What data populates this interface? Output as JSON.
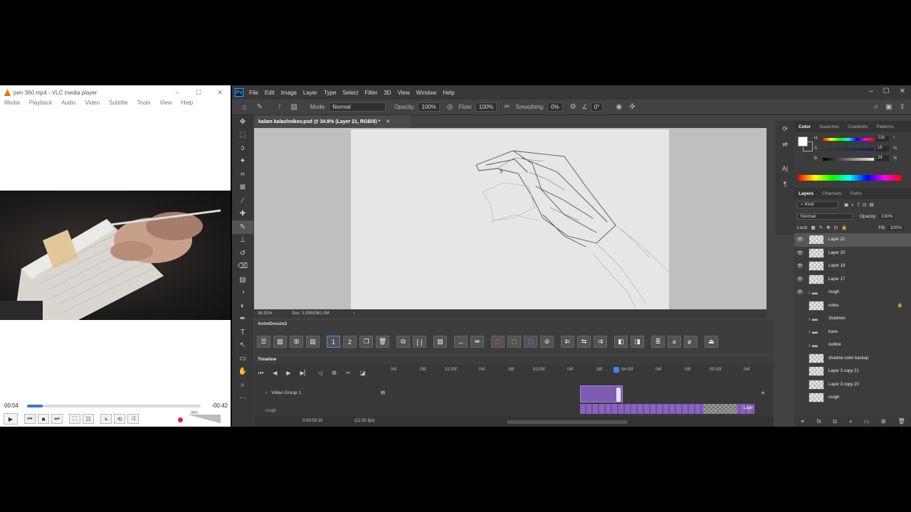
{
  "vlc": {
    "title": "pen 360.mp4 - VLC media player",
    "menu": [
      "Media",
      "Playback",
      "Audio",
      "Video",
      "Subtitle",
      "Tools",
      "View",
      "Help"
    ],
    "elapsed": "00:04",
    "remaining": "-00:42",
    "progress_fraction": 0.09,
    "volume_label": "30%"
  },
  "ps": {
    "menu": [
      "File",
      "Edit",
      "Image",
      "Layer",
      "Type",
      "Select",
      "Filter",
      "3D",
      "View",
      "Window",
      "Help"
    ],
    "options": {
      "mode_label": "Mode:",
      "mode_value": "Normal",
      "opacity_label": "Opacity:",
      "opacity_value": "100%",
      "flow_label": "Flow:",
      "flow_value": "100%",
      "smoothing_label": "Smoothing:",
      "smoothing_value": "0%",
      "angle_value": "0°",
      "brush_size": "7"
    },
    "doc_tab": "kalam kalashnikov.psd @ 34.9% (Layer 21, RGB/8) *",
    "status": {
      "zoom": "34.91%",
      "doc": "Doc: 5.93M/361.5M"
    },
    "anim_panel_title": "AnimDessin2",
    "timeline": {
      "title": "Timeline",
      "ruler": [
        "04f",
        "08f",
        "02:00f",
        "04f",
        "08f",
        "03:00f",
        "04f",
        "08f",
        "04:00f",
        "04f",
        "08f",
        "05:00f",
        "04f"
      ],
      "track1": "Video Group 1",
      "track2": "rough",
      "timecode": "0:00:03:10",
      "fps": "(12.00 fps)",
      "clip_label": "Laye"
    },
    "color_panel": {
      "tabs": [
        "Color",
        "Swatches",
        "Gradients",
        "Patterns"
      ],
      "h": "216",
      "s": "16",
      "b": "24",
      "h_label": "H",
      "s_label": "S",
      "b_label": "B",
      "pct": "%",
      "deg": "°"
    },
    "layers_panel": {
      "tabs": [
        "Layers",
        "Channels",
        "Paths"
      ],
      "kind": "Kind",
      "blend": "Normal",
      "opacity_label": "Opacity:",
      "opacity": "100%",
      "lock_label": "Lock:",
      "fill_label": "Fill:",
      "fill": "100%",
      "layers": [
        {
          "name": "Layer 21",
          "type": "layer",
          "visible": true,
          "selected": true
        },
        {
          "name": "Layer 20",
          "type": "layer",
          "visible": true
        },
        {
          "name": "Layer 18",
          "type": "layer",
          "visible": true
        },
        {
          "name": "Layer 17",
          "type": "layer",
          "visible": true
        },
        {
          "name": "rough",
          "type": "group",
          "visible": true
        },
        {
          "name": "notes",
          "type": "layer",
          "visible": false,
          "locked": true
        },
        {
          "name": "shadows",
          "type": "group",
          "visible": false
        },
        {
          "name": "base",
          "type": "group",
          "visible": false
        },
        {
          "name": "outline",
          "type": "group",
          "visible": false
        },
        {
          "name": "shadow color backup",
          "type": "layer",
          "visible": false
        },
        {
          "name": "Layer 3 copy 21",
          "type": "layer",
          "visible": false
        },
        {
          "name": "Layer 3 copy 20",
          "type": "layer",
          "visible": false
        },
        {
          "name": "rough",
          "type": "layer",
          "visible": false
        }
      ]
    }
  }
}
